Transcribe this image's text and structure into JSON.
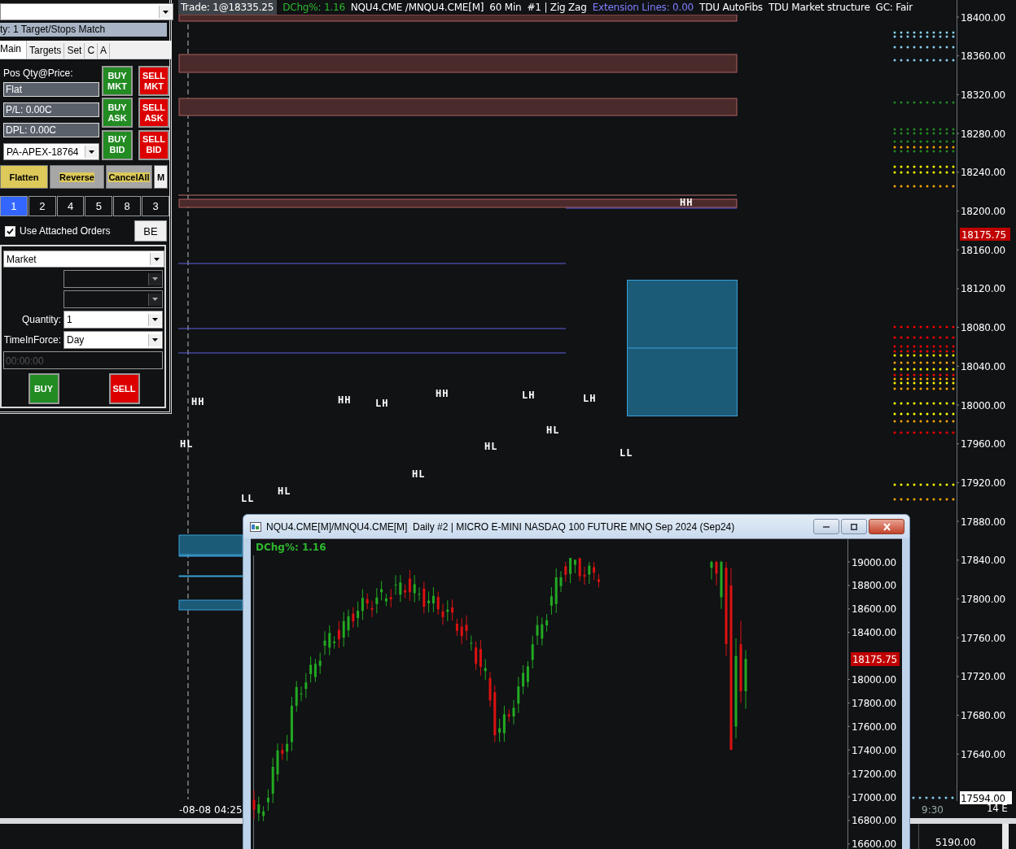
{
  "order_panel": {
    "instrument_selector": {
      "expanded": false
    },
    "strategy_bar": "ty: 1 Target/Stops Match",
    "tabs": [
      {
        "label": "Main",
        "selected": true
      },
      {
        "label": "Targets",
        "selected": false
      },
      {
        "label": "Set",
        "selected": false
      },
      {
        "label": "C",
        "selected": false
      },
      {
        "label": "A",
        "selected": false
      }
    ],
    "position_label": "Pos Qty@Price:",
    "fields": [
      "Flat",
      "P/L: 0.00C",
      "DPL: 0.00C"
    ],
    "account": "PA-APEX-18764",
    "order_buttons": [
      {
        "label": "BUY MKT",
        "kind": "buy"
      },
      {
        "label": "SELL MKT",
        "kind": "sell"
      },
      {
        "label": "BUY ASK",
        "kind": "buy"
      },
      {
        "label": "SELL ASK",
        "kind": "sell"
      },
      {
        "label": "BUY BID",
        "kind": "buy"
      },
      {
        "label": "SELL BID",
        "kind": "sell"
      }
    ],
    "action_buttons": [
      {
        "label": "Flatten",
        "kind": "flatten"
      },
      {
        "label": "Reverse",
        "kind": "reverse"
      },
      {
        "label": "CancelAll",
        "kind": "cancel"
      },
      {
        "label": "M",
        "kind": "plain"
      }
    ],
    "quantity_presets": [
      {
        "label": "1",
        "selected": true
      },
      {
        "label": "2",
        "selected": false
      },
      {
        "label": "4",
        "selected": false
      },
      {
        "label": "5",
        "selected": false
      },
      {
        "label": "8",
        "selected": false
      },
      {
        "label": "3",
        "selected": false
      }
    ],
    "attached_orders": {
      "label": "Use Attached Orders",
      "checked": true
    },
    "be_button": "BE",
    "order_type": "Market",
    "quantity": {
      "label": "Quantity:",
      "value": "1"
    },
    "time_in_force": {
      "label": "TimeInForce:",
      "value": "Day"
    },
    "time_field": {
      "value": "00:00:00",
      "disabled": true
    },
    "submit_buttons": [
      {
        "label": "BUY",
        "kind": "buy"
      },
      {
        "label": "SELL",
        "kind": "sell"
      }
    ]
  },
  "chart": {
    "info_bar": [
      {
        "text": "Trade: 1@18335.25",
        "kind": "boxed"
      },
      {
        "text": "DChg%: 1.16",
        "kind": "plain",
        "color": "#2eb82e"
      },
      {
        "text": "NQU4.CME /MNQU4.CME[M]",
        "kind": "plain",
        "color": "#ffffff"
      },
      {
        "text": "60 Min",
        "kind": "plain",
        "color": "#ffffff"
      },
      {
        "text": "#1 | Zig Zag",
        "kind": "plain",
        "color": "#ffffff"
      },
      {
        "text": "Extension Lines: 0.00",
        "kind": "plain",
        "color": "#7f7fff"
      },
      {
        "text": "TDU AutoFibs",
        "kind": "plain",
        "color": "#ffffff"
      },
      {
        "text": "TDU Market structure",
        "kind": "plain",
        "color": "#ffffff"
      },
      {
        "text": "GC: Fair",
        "kind": "plain",
        "color": "#ffffff"
      }
    ],
    "swing_labels": [
      "HL",
      "HH",
      "LL",
      "HL",
      "HH",
      "LH",
      "HL",
      "HH",
      "HL",
      "LH",
      "HL",
      "LH",
      "LL",
      "HH"
    ],
    "price_axis": [
      "18400.00",
      "18360.00",
      "18320.00",
      "18280.00",
      "18240.00",
      "18200.00",
      "18160.00",
      "18120.00",
      "18080.00",
      "18040.00",
      "18000.00",
      "17960.00",
      "17920.00",
      "17880.00",
      "17840.00",
      "17800.00",
      "17760.00",
      "17720.00",
      "17680.00",
      "17640.00"
    ],
    "last_price": "18175.75",
    "marker_price": "17594.00",
    "time_axis": [
      "-08-08 04:25",
      "9:30"
    ],
    "axis_footer": "14 E"
  },
  "daily_window": {
    "title": "NQU4.CME[M]/MNQU4.CME[M]  Daily #2 | MICRO E-MINI NASDAQ 100 FUTURE MNQ Sep 2024 (Sep24)",
    "indicator": "DChg%: 1.16",
    "price_axis": [
      "19000.00",
      "18800.00",
      "18600.00",
      "18400.00",
      "18000.00",
      "17800.00",
      "17600.00",
      "17400.00",
      "17200.00",
      "17000.00",
      "16800.00",
      "16600.00"
    ],
    "last_price": "18175.75"
  },
  "lower_pane": {
    "price_axis": [
      "5190.00"
    ]
  }
}
